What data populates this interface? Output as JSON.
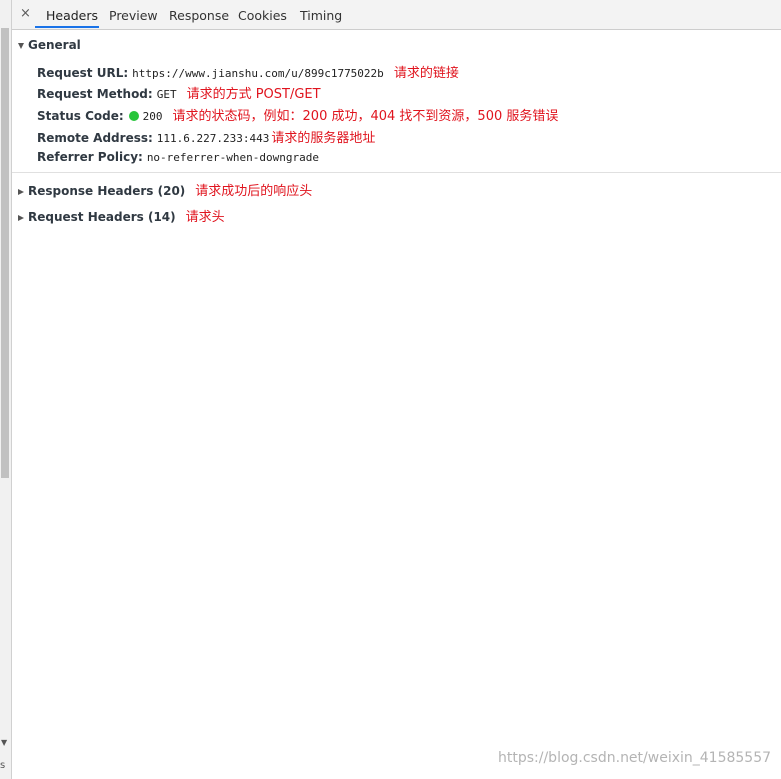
{
  "tabs": {
    "close": "×",
    "items": [
      "Headers",
      "Preview",
      "Response",
      "Cookies",
      "Timing"
    ]
  },
  "general": {
    "title": "General",
    "rows": [
      {
        "key": "Request URL:",
        "value": "https://www.jianshu.com/u/899c1775022b",
        "note": "请求的链接"
      },
      {
        "key": "Request Method:",
        "value": "GET",
        "note": "请求的方式 POST/GET"
      },
      {
        "key": "Status Code:",
        "value": "200",
        "note": "请求的状态码，例如：200 成功，404 找不到资源，500 服务错误"
      },
      {
        "key": "Remote Address:",
        "value": "111.6.227.233:443",
        "note": "请求的服务器地址"
      },
      {
        "key": "Referrer Policy:",
        "value": "no-referrer-when-downgrade"
      }
    ]
  },
  "response_headers": {
    "title": "Response Headers (20)",
    "note": "请求成功后的响应头"
  },
  "request_headers": {
    "title": "Request Headers (14)",
    "note": "请求头"
  },
  "sidebar": {
    "scroll_down": "▼",
    "label": "s"
  },
  "watermark": "https://blog.csdn.net/weixin_41585557",
  "colors": {
    "accent": "#1a73e8",
    "note": "#e0141e",
    "status_dot": "#27c53a"
  }
}
